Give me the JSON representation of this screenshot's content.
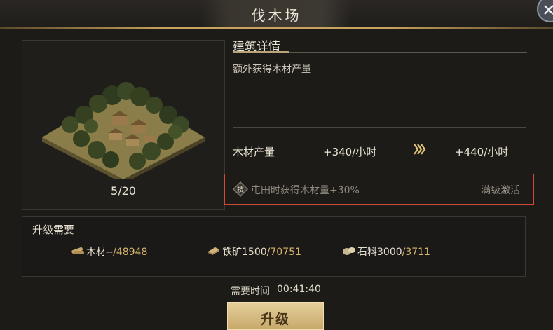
{
  "window": {
    "title": "伐木场"
  },
  "building": {
    "level": "5/20"
  },
  "details": {
    "section_title": "建筑详情",
    "description": "额外获得木材产量"
  },
  "production": {
    "label": "木材产量",
    "current": "+340/小时",
    "next": "+440/小时"
  },
  "bonus": {
    "icon_char": "技",
    "text": "屯田时获得木材量+30%",
    "status": "满级激活"
  },
  "requirements": {
    "title": "升级需要",
    "items": [
      {
        "name": "木材",
        "current": "--",
        "total": "/48948",
        "icon": "wood-icon"
      },
      {
        "name": "铁矿",
        "current": "1500",
        "total": "/70751",
        "icon": "iron-icon"
      },
      {
        "name": "石料",
        "current": "3000",
        "total": "/3711",
        "icon": "stone-icon"
      }
    ]
  },
  "time": {
    "label": "需要时间",
    "value": "00:41:40"
  },
  "actions": {
    "upgrade_label": "升级"
  },
  "colors": {
    "accent_gold": "#c7a35d",
    "highlight_red": "#d04a3a",
    "button_gold": "#d8bd84"
  }
}
